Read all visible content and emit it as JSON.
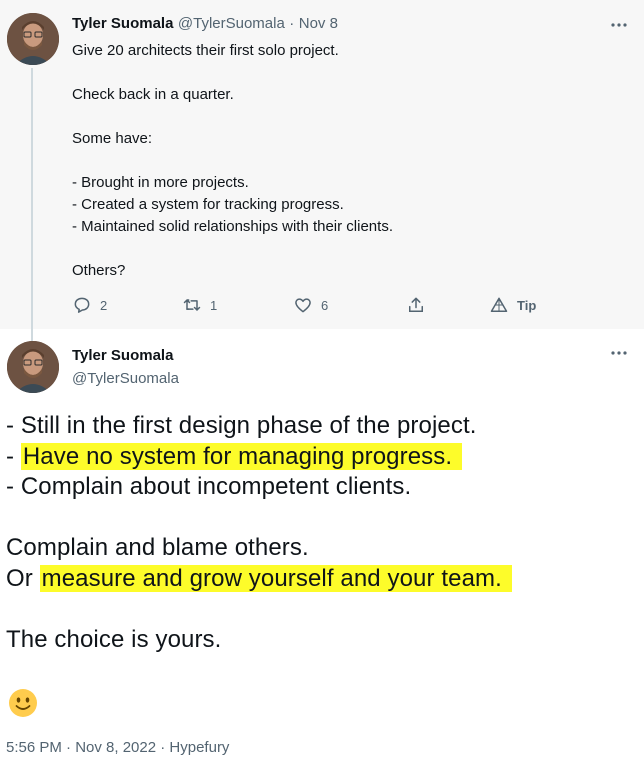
{
  "parent_tweet": {
    "author_name": "Tyler Suomala",
    "author_handle": "@TylerSuomala",
    "separator": "·",
    "date": "Nov 8",
    "lines": [
      "Give 20 architects their first solo project.",
      "",
      "Check back in a quarter.",
      "",
      "Some have:",
      "",
      "- Brought in more projects.",
      "- Created a system for tracking progress.",
      "- Maintained solid relationships with their clients.",
      "",
      "Others?"
    ],
    "actions": {
      "reply_count": "2",
      "retweet_count": "1",
      "like_count": "6",
      "tip_label": "Tip"
    }
  },
  "main_tweet": {
    "author_name": "Tyler Suomala",
    "author_handle": "@TylerSuomala",
    "lines": {
      "l1": "- Still in the first design phase of the project.",
      "l2_prefix": "- ",
      "l2_highlight": "Have no system for managing progress.",
      "l3": "- Complain about incompetent clients.",
      "l4": "Complain and blame others.",
      "l5_prefix": "Or ",
      "l5_highlight": "measure and grow yourself and your team.",
      "l6": "The choice is yours."
    },
    "emoji": "slightly-smiling-face",
    "timestamp": "5:56 PM · Nov 8, 2022 · Hypefury"
  },
  "colors": {
    "highlight": "#fdfc2a",
    "muted_text": "#536471",
    "top_background": "#f7f7f7"
  }
}
